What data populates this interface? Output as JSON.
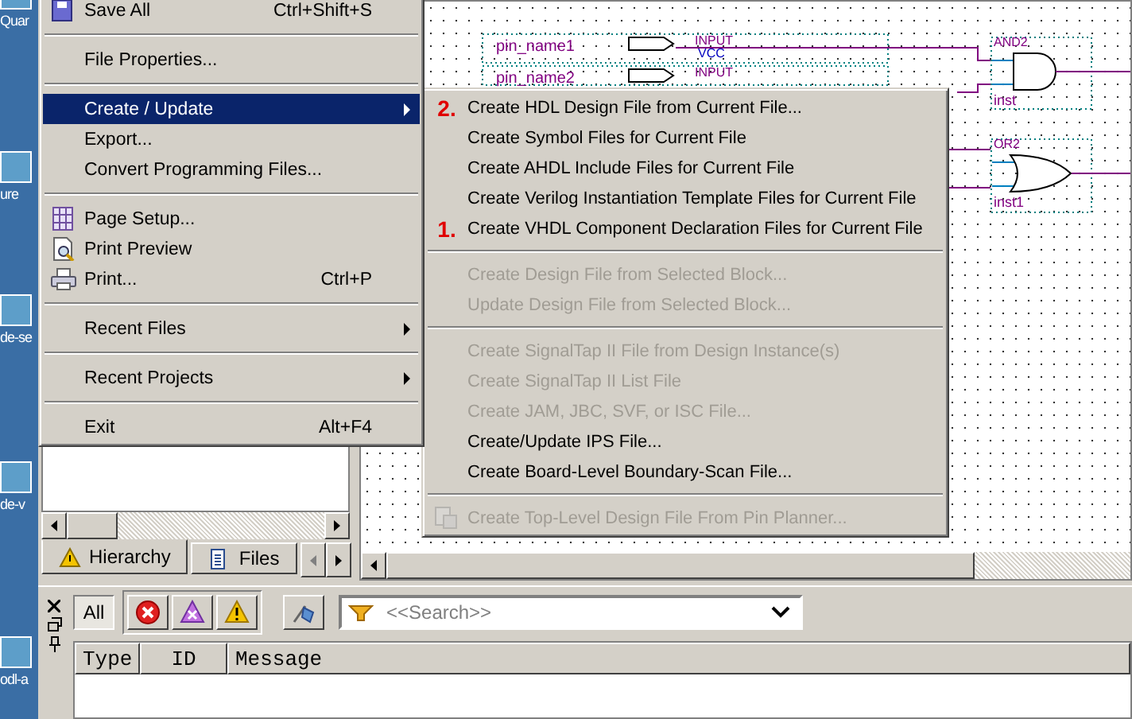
{
  "desktop": {
    "items": [
      {
        "label": "Quar"
      },
      {
        "label": "ure"
      },
      {
        "label": "de-se"
      },
      {
        "label": "de-v"
      },
      {
        "label": "odl-a"
      }
    ]
  },
  "schematic": {
    "pins": [
      {
        "name": "pin_name1",
        "type": "INPUT",
        "value": "VCC"
      },
      {
        "name": "pin_name2",
        "type": "INPUT"
      }
    ],
    "gates": [
      {
        "kind": "and",
        "type": "AND2",
        "instance": "inst"
      },
      {
        "kind": "or",
        "type": "OR2",
        "instance": "inst1"
      }
    ]
  },
  "navigator": {
    "tabs": [
      {
        "label": "Hierarchy",
        "selected": true
      },
      {
        "label": "Files",
        "selected": false
      }
    ]
  },
  "messages": {
    "filters": [
      {
        "kind": "all",
        "label": "All",
        "pressed": true
      },
      {
        "kind": "error",
        "pressed": false
      },
      {
        "kind": "critical",
        "pressed": false
      },
      {
        "kind": "warning",
        "pressed": false
      },
      {
        "kind": "flag",
        "pressed": false
      }
    ],
    "search": {
      "placeholder": "<<Search>>"
    },
    "columns": [
      "Type",
      "ID",
      "Message"
    ]
  },
  "file_menu": {
    "items": [
      {
        "kind": "item",
        "label": "Save All",
        "shortcut": "Ctrl+Shift+S",
        "has_submenu": false,
        "selected": false
      },
      {
        "kind": "separator"
      },
      {
        "kind": "item",
        "label": "File Properties...",
        "has_submenu": false,
        "selected": false
      },
      {
        "kind": "separator"
      },
      {
        "kind": "item",
        "label": "Create / Update",
        "has_submenu": true,
        "selected": true
      },
      {
        "kind": "item",
        "label": "Export...",
        "has_submenu": false,
        "selected": false
      },
      {
        "kind": "item",
        "label": "Convert Programming Files...",
        "has_submenu": false,
        "selected": false
      },
      {
        "kind": "separator"
      },
      {
        "kind": "item",
        "label": "Page Setup...",
        "has_submenu": false,
        "selected": false
      },
      {
        "kind": "item",
        "label": "Print Preview",
        "has_submenu": false,
        "selected": false
      },
      {
        "kind": "item",
        "label": "Print...",
        "shortcut": "Ctrl+P",
        "has_submenu": false,
        "selected": false
      },
      {
        "kind": "separator"
      },
      {
        "kind": "item",
        "label": "Recent Files",
        "has_submenu": true,
        "selected": false
      },
      {
        "kind": "separator"
      },
      {
        "kind": "item",
        "label": "Recent Projects",
        "has_submenu": true,
        "selected": false
      },
      {
        "kind": "separator"
      },
      {
        "kind": "item",
        "label": "Exit",
        "shortcut": "Alt+F4",
        "has_submenu": false,
        "selected": false
      }
    ]
  },
  "create_update_submenu": {
    "items": [
      {
        "kind": "item",
        "label": "Create HDL Design File from Current File...",
        "marker": "2.",
        "disabled": false,
        "selected": false
      },
      {
        "kind": "item",
        "label": "Create Symbol Files for Current File",
        "disabled": false,
        "selected": false
      },
      {
        "kind": "item",
        "label": "Create AHDL Include Files for Current File",
        "disabled": false,
        "selected": false
      },
      {
        "kind": "item",
        "label": "Create Verilog Instantiation Template Files for Current File",
        "disabled": false,
        "selected": false
      },
      {
        "kind": "item",
        "label": "Create VHDL Component Declaration Files for Current File",
        "marker": "1.",
        "disabled": false,
        "selected": false
      },
      {
        "kind": "separator"
      },
      {
        "kind": "item",
        "label": "Create Design File from Selected Block...",
        "disabled": true,
        "selected": false
      },
      {
        "kind": "item",
        "label": "Update Design File from Selected Block...",
        "disabled": true,
        "selected": false
      },
      {
        "kind": "separator"
      },
      {
        "kind": "item",
        "label": "Create SignalTap II File from Design Instance(s)",
        "disabled": true,
        "selected": false
      },
      {
        "kind": "item",
        "label": "Create SignalTap II List File",
        "disabled": true,
        "selected": false
      },
      {
        "kind": "item",
        "label": "Create JAM, JBC, SVF, or ISC File...",
        "disabled": true,
        "selected": false
      },
      {
        "kind": "item",
        "label": "Create/Update IPS File...",
        "disabled": false,
        "selected": false
      },
      {
        "kind": "item",
        "label": "Create Board-Level Boundary-Scan File...",
        "disabled": false,
        "selected": false
      },
      {
        "kind": "separator"
      },
      {
        "kind": "item",
        "label": "Create Top-Level Design File From Pin Planner...",
        "disabled": true,
        "selected": false
      }
    ]
  }
}
